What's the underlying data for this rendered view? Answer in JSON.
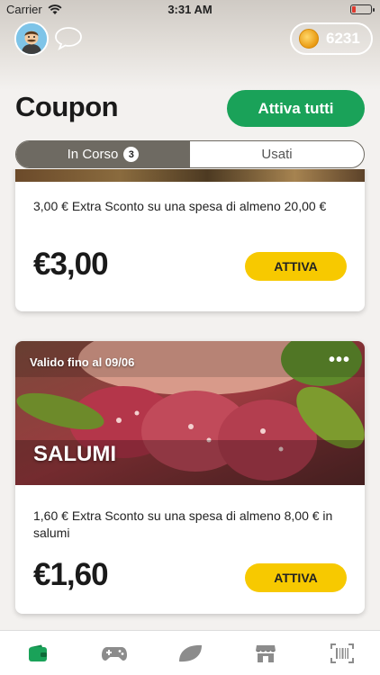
{
  "status_bar": {
    "carrier": "Carrier",
    "time": "3:31 AM"
  },
  "header": {
    "coins": "6231"
  },
  "page": {
    "title": "Coupon",
    "activate_all_label": "Attiva tutti"
  },
  "tabs": [
    {
      "label": "In Corso",
      "badge": "3",
      "active": true
    },
    {
      "label": "Usati",
      "active": false
    }
  ],
  "coupons": [
    {
      "description": "3,00 € Extra Sconto su una spesa di almeno 20,00 €",
      "value": "€3,00",
      "button_label": "ATTIVA"
    },
    {
      "validity": "Valido fino al 09/06",
      "category": "SALUMI",
      "description": "1,60 € Extra Sconto su una spesa di almeno 8,00 € in salumi",
      "value": "€1,60",
      "button_label": "ATTIVA"
    }
  ],
  "tabbar": {
    "items": [
      {
        "icon": "wallet-icon",
        "active": true
      },
      {
        "icon": "gamepad-icon",
        "active": false
      },
      {
        "icon": "leaf-icon",
        "active": false
      },
      {
        "icon": "store-icon",
        "active": false
      },
      {
        "icon": "barcode-icon",
        "active": false
      }
    ]
  },
  "colors": {
    "accent_green": "#1aa259",
    "coupon_button_yellow": "#f7c900",
    "segmented_active": "#6e6a62",
    "battery_low": "#e03a2f"
  }
}
